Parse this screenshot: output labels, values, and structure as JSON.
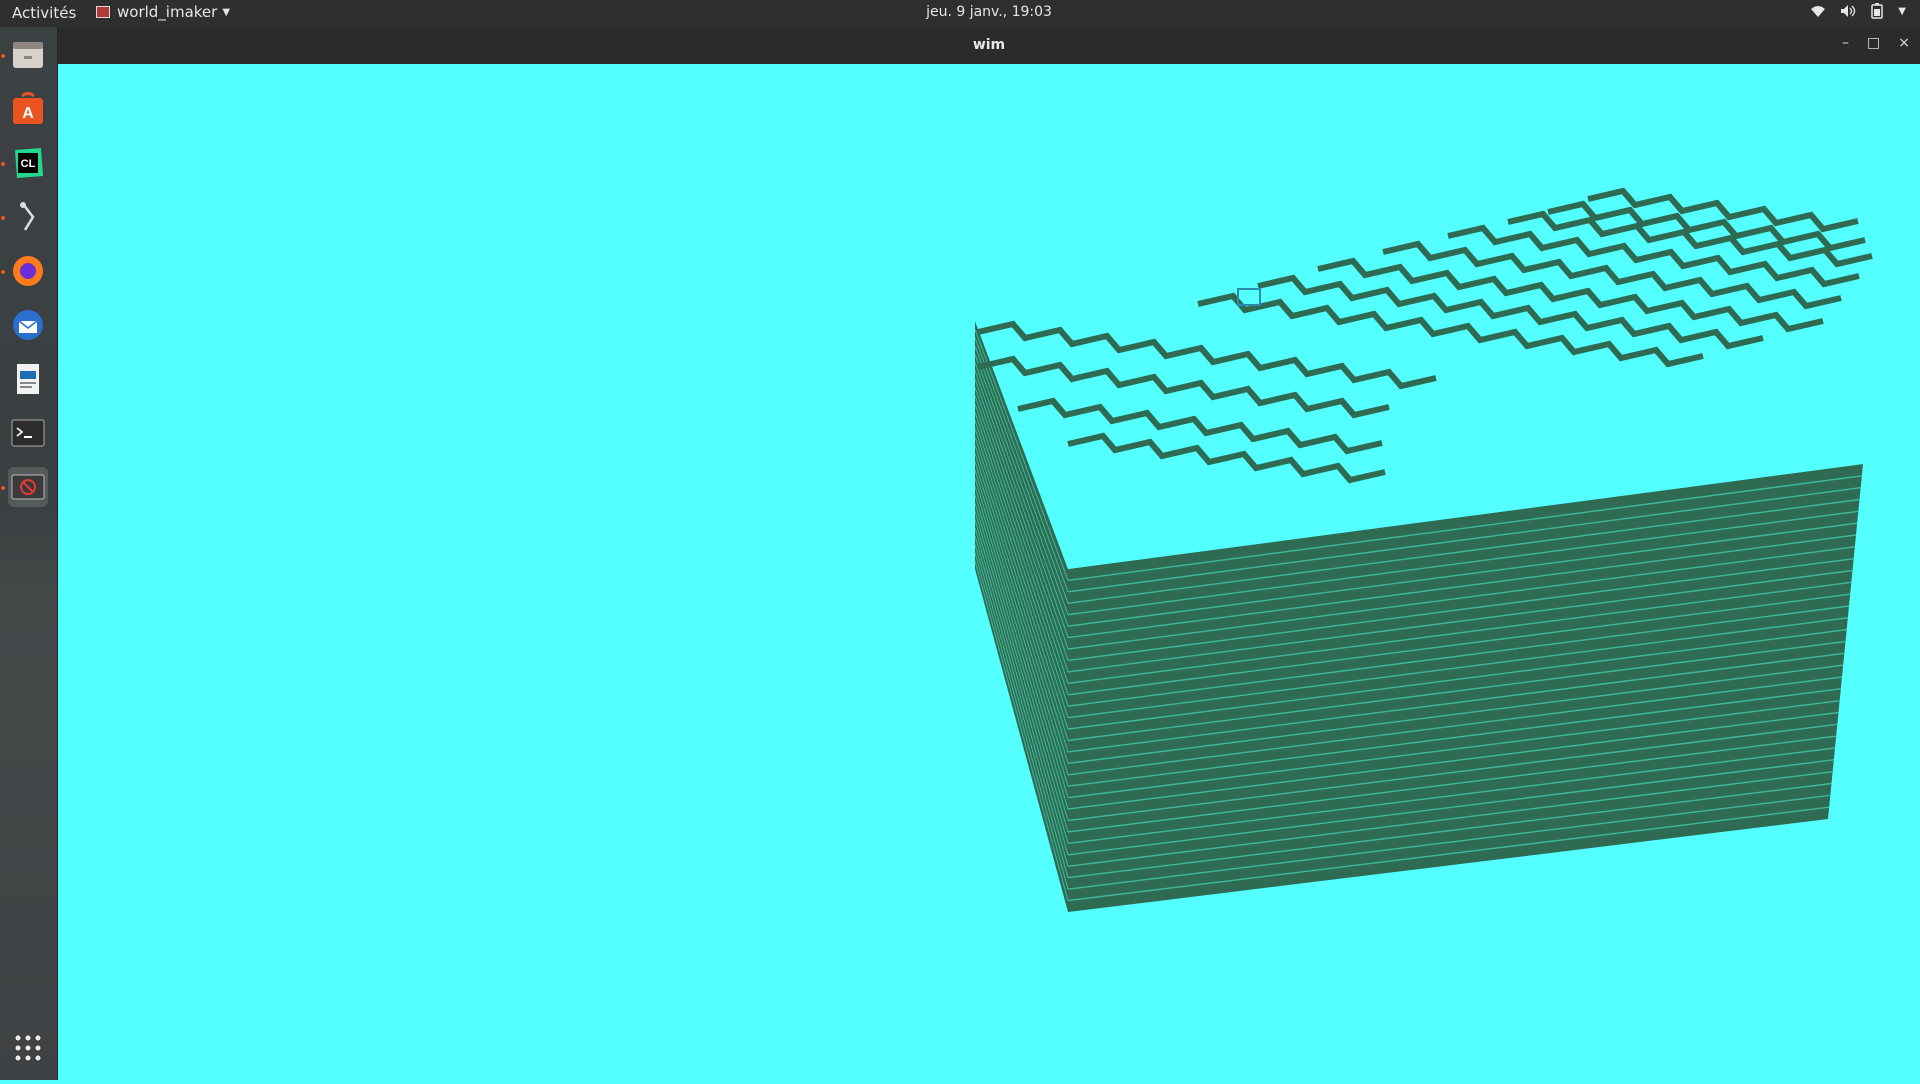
{
  "topbar": {
    "activities": "Activités",
    "app_name": "world_imaker",
    "clock": "jeu.  9 janv., 19:03"
  },
  "window": {
    "title": "wim",
    "minimize": "–",
    "maximize": "□",
    "close": "×"
  },
  "dock": {
    "items": [
      "files-icon",
      "software-icon",
      "clion-icon",
      "git-icon",
      "firefox-icon",
      "thunderbird-icon",
      "writer-icon",
      "terminal-icon",
      "world-imaker-icon"
    ],
    "apps_grid": "show-applications-icon"
  },
  "scene": {
    "background_color": "#53ffff",
    "block_color": "#2f6b52",
    "description_visible": ""
  }
}
